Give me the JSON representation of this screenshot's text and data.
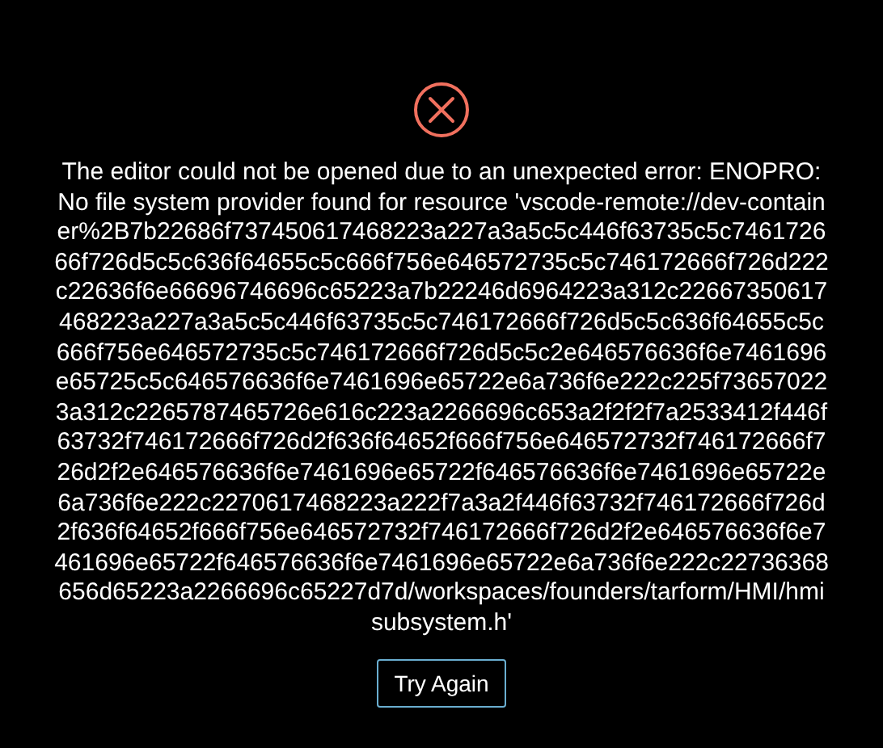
{
  "error": {
    "message": "The editor could not be opened due to an unexpected error: ENOPRO: No file system provider found for resource 'vscode-remote://dev-container%2B7b22686f737450617468223a227a3a5c5c446f63735c5c746172666f726d5c5c636f64655c5c666f756e646572735c5c746172666f726d222c22636f6e66696746696c65223a7b22246d6964223a312c22667350617468223a227a3a5c5c446f63735c5c746172666f726d5c5c636f64655c5c666f756e646572735c5c746172666f726d5c5c2e646576636f6e7461696e65725c5c646576636f6e7461696e65722e6a736f6e222c225f736570223a312c2265787465726e616c223a2266696c653a2f2f2f7a2533412f446f63732f746172666f726d2f636f64652f666f756e646572732f746172666f726d2f2e646576636f6e7461696e65722f646576636f6e7461696e65722e6a736f6e222c2270617468223a222f7a3a2f446f63732f746172666f726d2f636f64652f666f756e646572732f746172666f726d2f2e646576636f6e7461696e65722f646576636f6e7461696e65722e6a736f6e222c22736368656d65223a2266696c65227d7d/workspaces/founders/tarform/HMI/hmisubsystem.h'",
    "button": "Try Again"
  }
}
